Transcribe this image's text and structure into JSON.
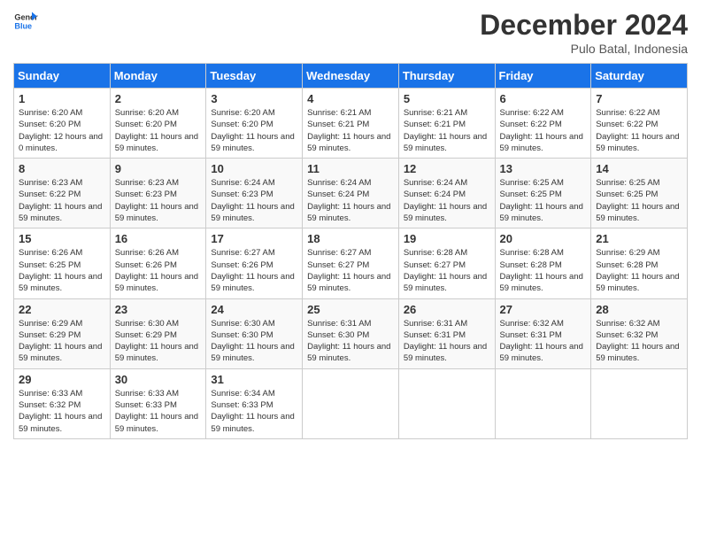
{
  "header": {
    "logo_line1": "General",
    "logo_line2": "Blue",
    "month_year": "December 2024",
    "location": "Pulo Batal, Indonesia"
  },
  "days_of_week": [
    "Sunday",
    "Monday",
    "Tuesday",
    "Wednesday",
    "Thursday",
    "Friday",
    "Saturday"
  ],
  "weeks": [
    [
      {
        "day": "1",
        "sunrise": "6:20 AM",
        "sunset": "6:20 PM",
        "daylight": "12 hours and 0 minutes."
      },
      {
        "day": "2",
        "sunrise": "6:20 AM",
        "sunset": "6:20 PM",
        "daylight": "11 hours and 59 minutes."
      },
      {
        "day": "3",
        "sunrise": "6:20 AM",
        "sunset": "6:20 PM",
        "daylight": "11 hours and 59 minutes."
      },
      {
        "day": "4",
        "sunrise": "6:21 AM",
        "sunset": "6:21 PM",
        "daylight": "11 hours and 59 minutes."
      },
      {
        "day": "5",
        "sunrise": "6:21 AM",
        "sunset": "6:21 PM",
        "daylight": "11 hours and 59 minutes."
      },
      {
        "day": "6",
        "sunrise": "6:22 AM",
        "sunset": "6:22 PM",
        "daylight": "11 hours and 59 minutes."
      },
      {
        "day": "7",
        "sunrise": "6:22 AM",
        "sunset": "6:22 PM",
        "daylight": "11 hours and 59 minutes."
      }
    ],
    [
      {
        "day": "8",
        "sunrise": "6:23 AM",
        "sunset": "6:22 PM",
        "daylight": "11 hours and 59 minutes."
      },
      {
        "day": "9",
        "sunrise": "6:23 AM",
        "sunset": "6:23 PM",
        "daylight": "11 hours and 59 minutes."
      },
      {
        "day": "10",
        "sunrise": "6:24 AM",
        "sunset": "6:23 PM",
        "daylight": "11 hours and 59 minutes."
      },
      {
        "day": "11",
        "sunrise": "6:24 AM",
        "sunset": "6:24 PM",
        "daylight": "11 hours and 59 minutes."
      },
      {
        "day": "12",
        "sunrise": "6:24 AM",
        "sunset": "6:24 PM",
        "daylight": "11 hours and 59 minutes."
      },
      {
        "day": "13",
        "sunrise": "6:25 AM",
        "sunset": "6:25 PM",
        "daylight": "11 hours and 59 minutes."
      },
      {
        "day": "14",
        "sunrise": "6:25 AM",
        "sunset": "6:25 PM",
        "daylight": "11 hours and 59 minutes."
      }
    ],
    [
      {
        "day": "15",
        "sunrise": "6:26 AM",
        "sunset": "6:25 PM",
        "daylight": "11 hours and 59 minutes."
      },
      {
        "day": "16",
        "sunrise": "6:26 AM",
        "sunset": "6:26 PM",
        "daylight": "11 hours and 59 minutes."
      },
      {
        "day": "17",
        "sunrise": "6:27 AM",
        "sunset": "6:26 PM",
        "daylight": "11 hours and 59 minutes."
      },
      {
        "day": "18",
        "sunrise": "6:27 AM",
        "sunset": "6:27 PM",
        "daylight": "11 hours and 59 minutes."
      },
      {
        "day": "19",
        "sunrise": "6:28 AM",
        "sunset": "6:27 PM",
        "daylight": "11 hours and 59 minutes."
      },
      {
        "day": "20",
        "sunrise": "6:28 AM",
        "sunset": "6:28 PM",
        "daylight": "11 hours and 59 minutes."
      },
      {
        "day": "21",
        "sunrise": "6:29 AM",
        "sunset": "6:28 PM",
        "daylight": "11 hours and 59 minutes."
      }
    ],
    [
      {
        "day": "22",
        "sunrise": "6:29 AM",
        "sunset": "6:29 PM",
        "daylight": "11 hours and 59 minutes."
      },
      {
        "day": "23",
        "sunrise": "6:30 AM",
        "sunset": "6:29 PM",
        "daylight": "11 hours and 59 minutes."
      },
      {
        "day": "24",
        "sunrise": "6:30 AM",
        "sunset": "6:30 PM",
        "daylight": "11 hours and 59 minutes."
      },
      {
        "day": "25",
        "sunrise": "6:31 AM",
        "sunset": "6:30 PM",
        "daylight": "11 hours and 59 minutes."
      },
      {
        "day": "26",
        "sunrise": "6:31 AM",
        "sunset": "6:31 PM",
        "daylight": "11 hours and 59 minutes."
      },
      {
        "day": "27",
        "sunrise": "6:32 AM",
        "sunset": "6:31 PM",
        "daylight": "11 hours and 59 minutes."
      },
      {
        "day": "28",
        "sunrise": "6:32 AM",
        "sunset": "6:32 PM",
        "daylight": "11 hours and 59 minutes."
      }
    ],
    [
      {
        "day": "29",
        "sunrise": "6:33 AM",
        "sunset": "6:32 PM",
        "daylight": "11 hours and 59 minutes."
      },
      {
        "day": "30",
        "sunrise": "6:33 AM",
        "sunset": "6:33 PM",
        "daylight": "11 hours and 59 minutes."
      },
      {
        "day": "31",
        "sunrise": "6:34 AM",
        "sunset": "6:33 PM",
        "daylight": "11 hours and 59 minutes."
      },
      null,
      null,
      null,
      null
    ]
  ]
}
